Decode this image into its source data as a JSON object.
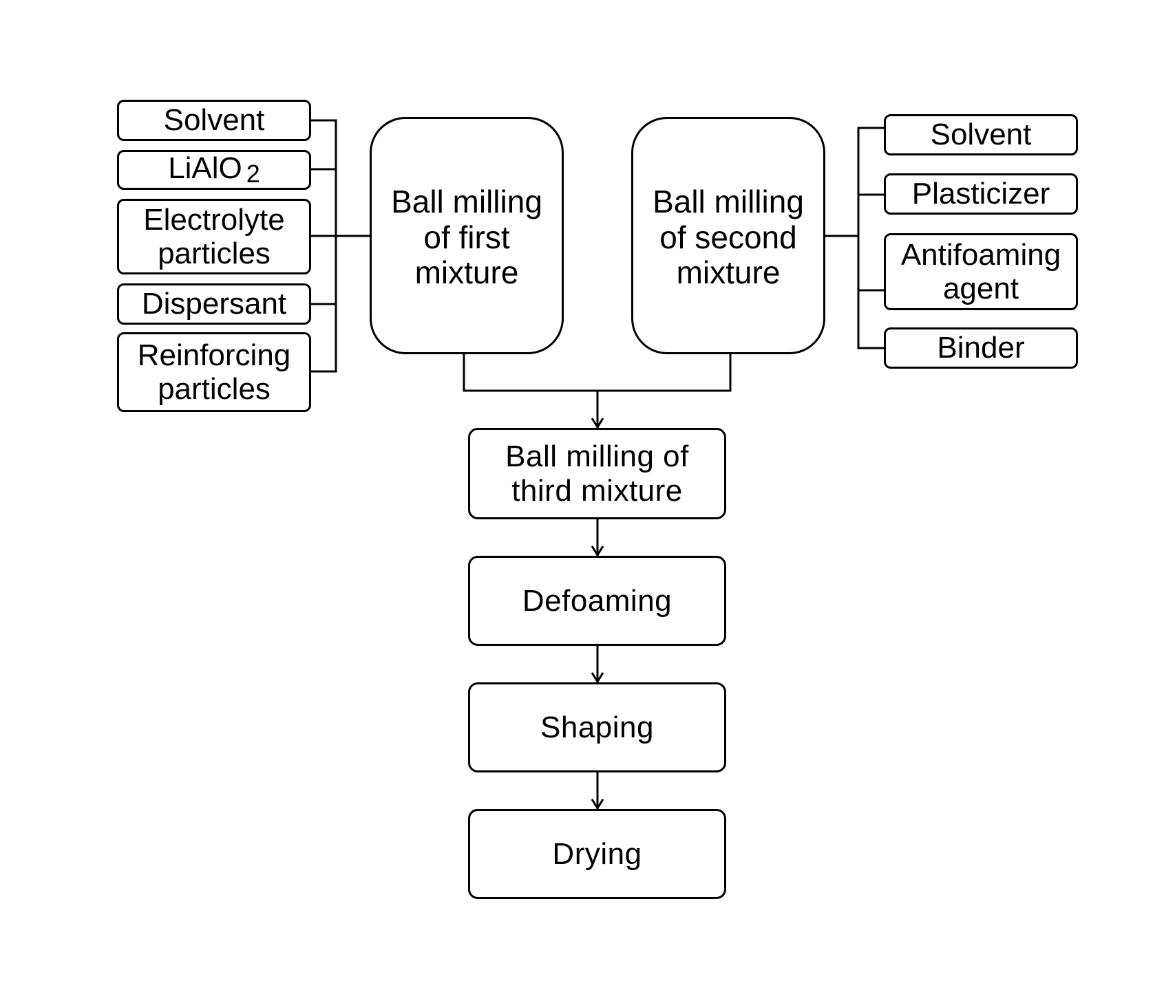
{
  "diagram": {
    "left_inputs": [
      {
        "label": "Solvent"
      },
      {
        "label": "LiAlO",
        "subscript": "2"
      },
      {
        "label": "Electrolyte particles"
      },
      {
        "label": "Dispersant"
      },
      {
        "label": "Reinforcing particles"
      }
    ],
    "right_inputs": [
      {
        "label": "Solvent"
      },
      {
        "label": "Plasticizer"
      },
      {
        "label": "Antifoaming agent"
      },
      {
        "label": "Binder"
      }
    ],
    "first_mixture": {
      "label": "Ball milling of first mixture"
    },
    "second_mixture": {
      "label": "Ball milling of second mixture"
    },
    "steps": [
      {
        "label": "Ball milling of third mixture"
      },
      {
        "label": "Defoaming"
      },
      {
        "label": "Shaping"
      },
      {
        "label": "Drying"
      }
    ]
  }
}
